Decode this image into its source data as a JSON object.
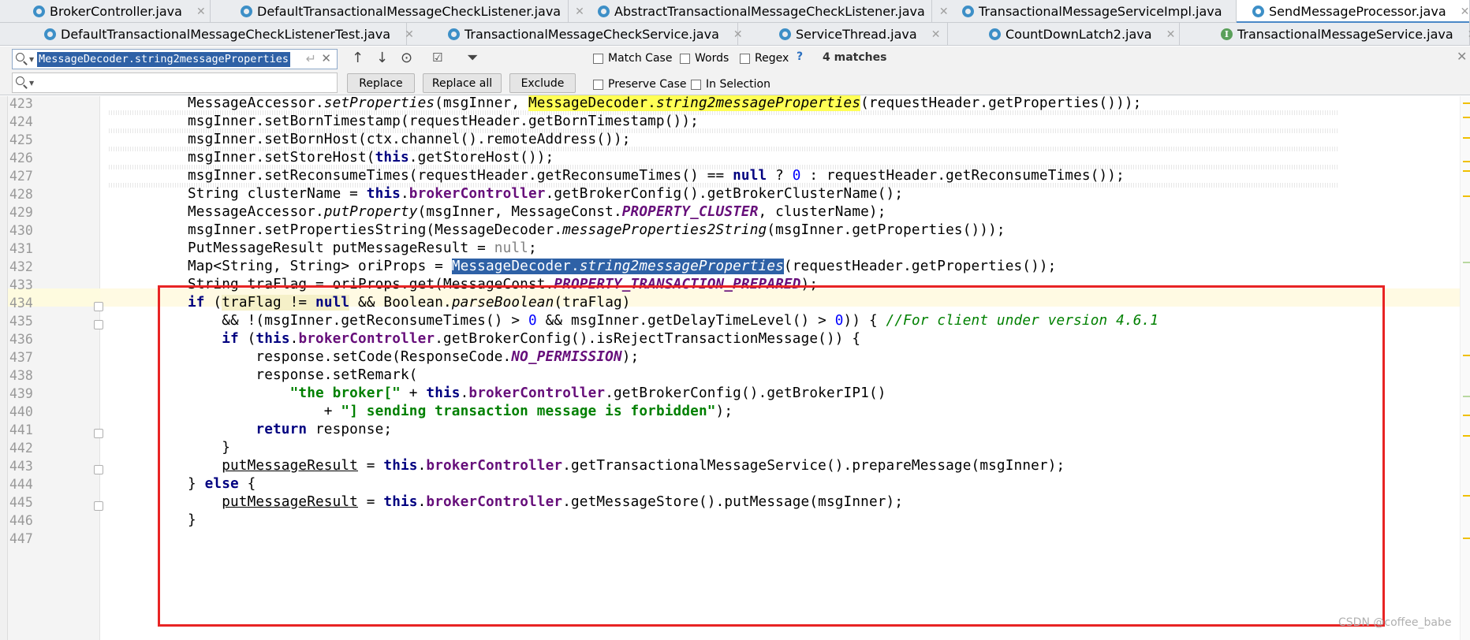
{
  "tabs_row1": [
    {
      "label": "BrokerController.java",
      "active": false
    },
    {
      "label": "DefaultTransactionalMessageCheckListener.java",
      "active": false
    },
    {
      "label": "AbstractTransactionalMessageCheckListener.java",
      "active": false
    },
    {
      "label": "TransactionalMessageServiceImpl.java",
      "active": false
    },
    {
      "label": "SendMessageProcessor.java",
      "active": true
    }
  ],
  "tabs_row2": [
    {
      "label": "DefaultTransactionalMessageCheckListenerTest.java",
      "icon": "class-icon"
    },
    {
      "label": "TransactionalMessageCheckService.java",
      "icon": "class-icon"
    },
    {
      "label": "ServiceThread.java",
      "icon": "class-icon"
    },
    {
      "label": "CountDownLatch2.java",
      "icon": "class-icon"
    },
    {
      "label": "TransactionalMessageService.java",
      "icon": "interface-icon"
    }
  ],
  "find": {
    "search_value": "MessageDecoder.string2messageProperties",
    "replace_value": "",
    "replace_label": "Replace",
    "replace_all_label": "Replace all",
    "exclude_label": "Exclude",
    "match_case_label": "Match Case",
    "words_label": "Words",
    "regex_label": "Regex",
    "help_label": "?",
    "preserve_case_label": "Preserve Case",
    "in_selection_label": "In Selection",
    "matches_label": "4 matches"
  },
  "editor": {
    "line_numbers": [
      "423",
      "424",
      "425",
      "426",
      "427",
      "428",
      "429",
      "430",
      "431",
      "432",
      "433",
      "434",
      "435",
      "436",
      "437",
      "438",
      "439",
      "440",
      "441",
      "442",
      "443",
      "444",
      "445",
      "446",
      "447"
    ],
    "current_line": "432"
  },
  "watermark": "CSDN @coffee_babe",
  "colors": {
    "keyword": "#000080",
    "field": "#660e7a",
    "string": "#008000",
    "number": "#0000ff",
    "search_highlight": "#ffff55",
    "selection": "#2e61a6",
    "annotation_box": "#e82424"
  }
}
